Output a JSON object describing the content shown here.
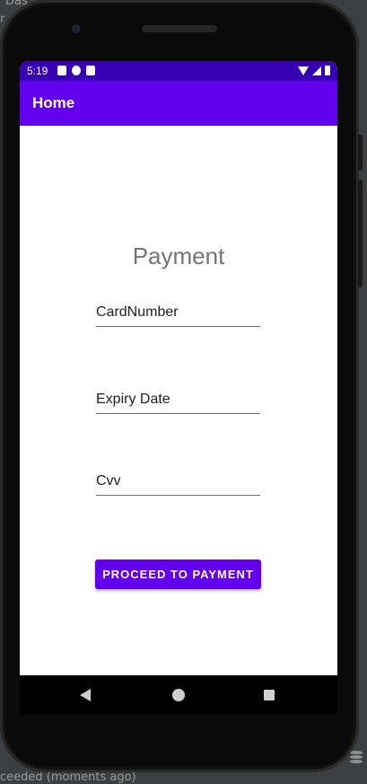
{
  "ide": {
    "top_fragment_1": "Das",
    "top_fragment_2": "r",
    "bottom_status": "ceeded (moments ago)"
  },
  "status_bar": {
    "time": "5:19"
  },
  "app_bar": {
    "title": "Home"
  },
  "form": {
    "heading": "Payment",
    "card_number_placeholder": "CardNumber",
    "expiry_placeholder": "Expiry Date",
    "cvv_placeholder": "Cvv",
    "submit_label": "PROCEED TO PAYMENT"
  },
  "colors": {
    "status_bar": "#3700b3",
    "primary": "#6200ee"
  },
  "icons": {
    "status_left": [
      "a-icon",
      "sync-icon",
      "sd-card-icon"
    ],
    "status_right": [
      "wifi-icon",
      "signal-icon",
      "battery-icon"
    ],
    "nav": [
      "back-icon",
      "home-icon",
      "recents-icon"
    ]
  }
}
